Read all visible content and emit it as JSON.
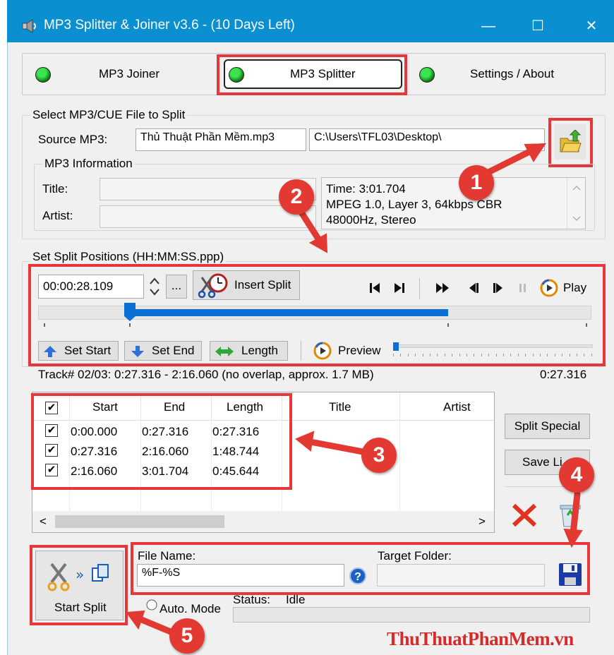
{
  "window": {
    "title": "MP3 Splitter & Joiner v3.6 - (10 Days Left)",
    "minimize_glyph": "—",
    "maximize_glyph": "☐",
    "close_glyph": "✕"
  },
  "mode_tabs": {
    "joiner": "MP3 Joiner",
    "splitter": "MP3 Splitter",
    "settings": "Settings / About"
  },
  "source": {
    "group_label": "Select MP3/CUE File to Split",
    "source_label": "Source MP3:",
    "filename": "Thủ Thuật Phần Mềm.mp3",
    "folder": "C:\\Users\\TFL03\\Desktop\\",
    "info_group_label": "MP3 Information",
    "title_label": "Title:",
    "artist_label": "Artist:",
    "title_value": "",
    "artist_value": "",
    "info_lines": [
      "Time: 3:01.704",
      "MPEG 1.0, Layer 3, 64kbps CBR",
      "48000Hz, Stereo"
    ]
  },
  "split": {
    "group_label": "Set Split Positions (HH:MM:SS.ppp)",
    "time_value": "00:00:28.109",
    "browse_label": "...",
    "insert_split_label": "Insert Split",
    "play_label": "Play",
    "set_start_label": "Set Start",
    "set_end_label": "Set End",
    "length_label": "Length",
    "preview_label": "Preview",
    "track_info": "Track# 02/03: 0:27.316 - 2:16.060 (no overlap, approx. 1.7 MB)",
    "current_time": "0:27.316",
    "selection_start_fraction": 0.165,
    "selection_end_fraction": 0.74,
    "preview_position_fraction": 0.0
  },
  "track_list": {
    "columns": [
      "Start",
      "End",
      "Length",
      "Title",
      "Artist"
    ],
    "rows": [
      {
        "checked": true,
        "start": "0:00.000",
        "end": "0:27.316",
        "length": "0:27.316",
        "title": "",
        "artist": ""
      },
      {
        "checked": true,
        "start": "0:27.316",
        "end": "2:16.060",
        "length": "1:48.744",
        "title": "",
        "artist": ""
      },
      {
        "checked": true,
        "start": "2:16.060",
        "end": "3:01.704",
        "length": "0:45.644",
        "title": "",
        "artist": ""
      }
    ],
    "check_glyph": "✔",
    "scroll_left": "<",
    "scroll_right": ">"
  },
  "side_buttons": {
    "split_special": "Split Special",
    "save_list": "Save Li"
  },
  "output": {
    "file_name_label": "File Name:",
    "file_name_value": "%F-%S",
    "target_folder_label": "Target Folder:",
    "target_folder_value": "",
    "help_glyph": "?"
  },
  "bottom": {
    "start_split_label": "Start Split",
    "auto_mode_label": "Auto. Mode",
    "status_label": "Status:",
    "status_value": "Idle",
    "progress_fraction": 0.0
  },
  "annotations": {
    "callouts": [
      "1",
      "2",
      "3",
      "4",
      "5"
    ],
    "watermark": "ThuThuatPhanMem.vn"
  },
  "colors": {
    "titlebar": "#0a8fd0",
    "highlight_box": "#e8373b",
    "callout": "#e23a32",
    "selection_bar": "#0a6fd4"
  }
}
